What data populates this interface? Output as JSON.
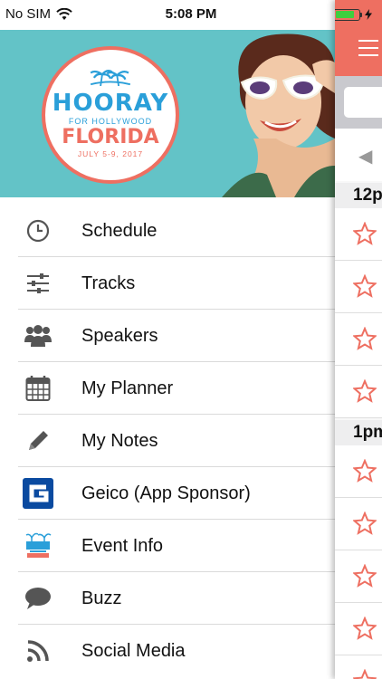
{
  "status_bar": {
    "carrier": "No SIM",
    "time": "5:08 PM",
    "battery_level": 0.8,
    "battery_color": "#3ecf3e"
  },
  "hero": {
    "logo": {
      "title": "HOORAY",
      "subtitle": "FOR HOLLYWOOD",
      "location": "FLORIDA",
      "dates": "JULY 5-9, 2017"
    },
    "background_color": "#63c3c7",
    "accent_color": "#ee6f61"
  },
  "menu": {
    "items": [
      {
        "label": "Schedule",
        "icon": "clock-icon"
      },
      {
        "label": "Tracks",
        "icon": "sliders-icon"
      },
      {
        "label": "Speakers",
        "icon": "people-icon"
      },
      {
        "label": "My Planner",
        "icon": "calendar-icon"
      },
      {
        "label": "My Notes",
        "icon": "pencil-icon"
      },
      {
        "label": "Geico (App Sponsor)",
        "icon": "geico-logo-icon"
      },
      {
        "label": "Event Info",
        "icon": "hooray-logo-icon"
      },
      {
        "label": "Buzz",
        "icon": "speech-bubble-icon"
      },
      {
        "label": "Social Media",
        "icon": "rss-icon"
      }
    ]
  },
  "side_panel": {
    "header_color": "#ee6f61",
    "time_headers": [
      "12p",
      "1pm"
    ],
    "star_color": "#ee6f61"
  }
}
